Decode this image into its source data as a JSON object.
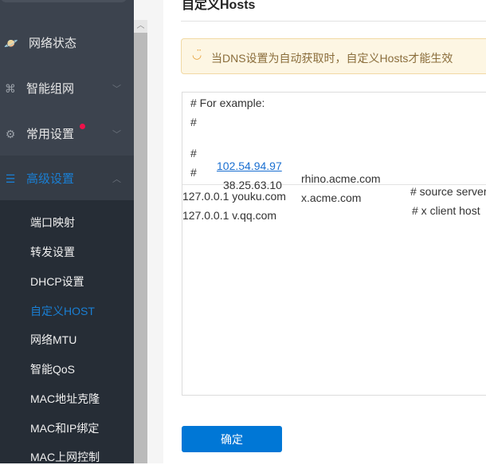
{
  "sidebar": {
    "menus": [
      {
        "label": "网络状态",
        "icon": "planet-icon"
      },
      {
        "label": "智能组网",
        "icon": "network-icon"
      },
      {
        "label": "常用设置",
        "icon": "gear-icon"
      },
      {
        "label": "高级设置",
        "icon": "document-icon"
      }
    ],
    "submenu": [
      "端口映射",
      "转发设置",
      "DHCP设置",
      "自定义HOST",
      "网络MTU",
      "智能QoS",
      "MAC地址克隆",
      "MAC和IP绑定",
      "MAC上网控制"
    ]
  },
  "main": {
    "title": "自定义Hosts",
    "alert": "当DNS设置为自动获取时，自定义Hosts才能生效",
    "example": {
      "l1": "# For example:",
      "l2": "#",
      "l3": {
        "hash": "#",
        "ip": "102.54.94.97",
        "host": "rhino.acme.com",
        "comment": "# source server"
      },
      "l4": {
        "hash": "#",
        "ip": "38.25.63.10",
        "host": "x.acme.com",
        "comment": "# x client host"
      }
    },
    "hosts": [
      "127.0.0.1 youku.com",
      "127.0.0.1 v.qq.com"
    ],
    "confirm": "确定"
  }
}
